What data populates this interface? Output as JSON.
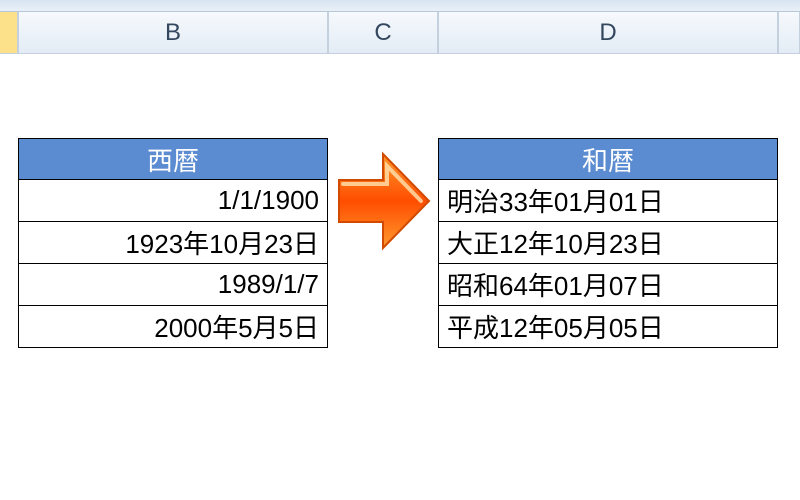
{
  "columns": {
    "B": "B",
    "C": "C",
    "D": "D"
  },
  "tables": {
    "western": {
      "header": "西暦",
      "rows": [
        "1/1/1900",
        "1923年10月23日",
        "1989/1/7",
        "2000年5月5日"
      ]
    },
    "japanese": {
      "header": "和暦",
      "rows": [
        "明治33年01月01日",
        "大正12年10月23日",
        "昭和64年01月07日",
        "平成12年05月05日"
      ]
    }
  },
  "icons": {
    "arrow": "right-arrow"
  }
}
